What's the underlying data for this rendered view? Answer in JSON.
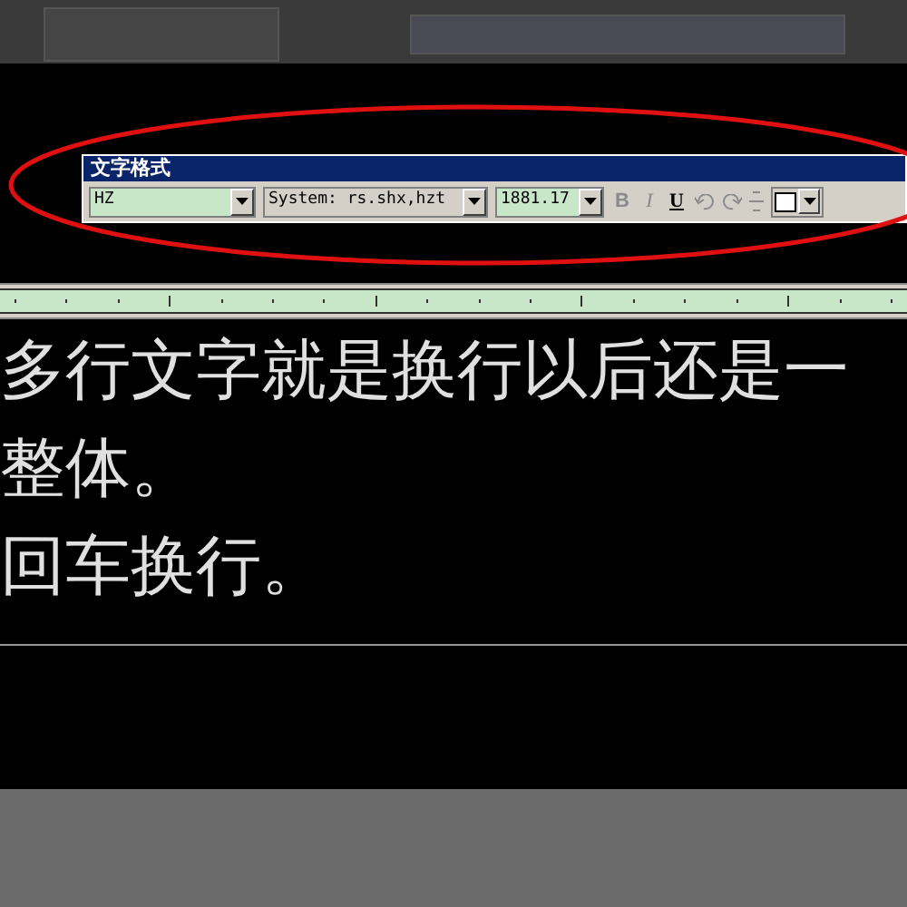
{
  "toolbar": {
    "title": "文字格式",
    "style_value": "HZ",
    "font_value": "System: rs.shx,hzt",
    "height_value": "1881.17",
    "bold_label": "B",
    "italic_label": "I",
    "underline_label": "U",
    "bold": false,
    "italic": false,
    "underline": true
  },
  "editor": {
    "lines": [
      "多行文字就是换行以后还是一",
      "整体。",
      "回车换行。"
    ]
  }
}
